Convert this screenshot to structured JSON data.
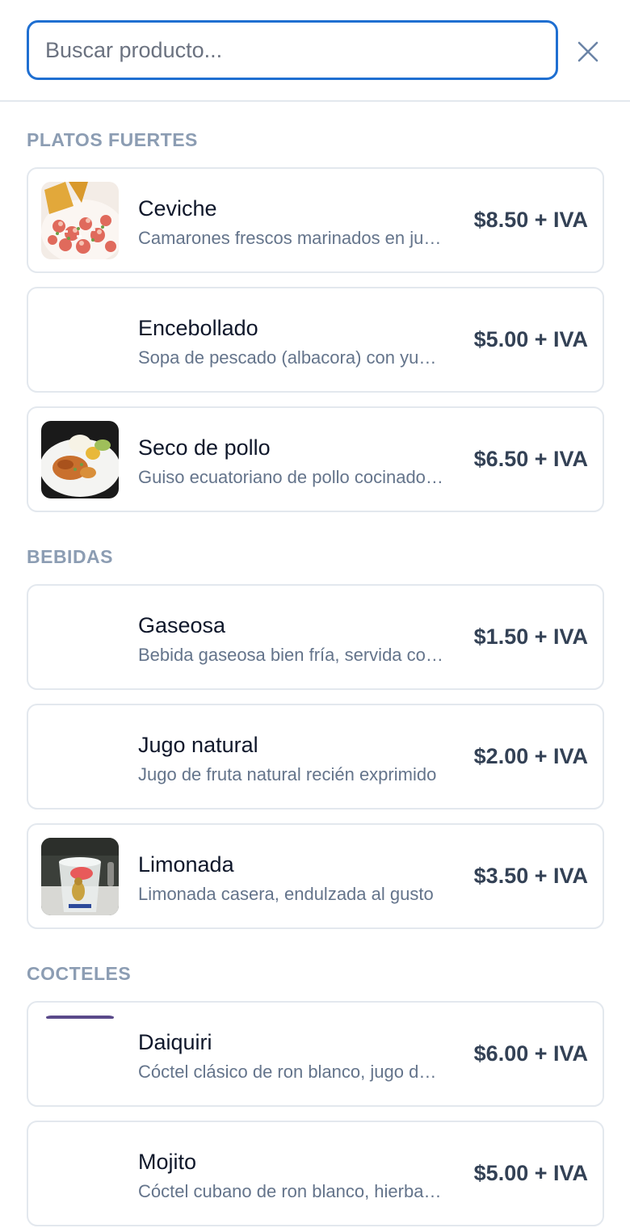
{
  "search": {
    "placeholder": "Buscar producto...",
    "value": ""
  },
  "sections": [
    {
      "title": "PLATOS FUERTES",
      "items": [
        {
          "name": "Ceviche",
          "description": "Camarones frescos marinados en jugo de limón",
          "price": "$8.50 + IVA",
          "image": "ceviche-photo"
        },
        {
          "name": "Encebollado",
          "description": "Sopa de pescado (albacora) con yuca y cebolla",
          "price": "$5.00 + IVA",
          "image": ""
        },
        {
          "name": "Seco de pollo",
          "description": "Guiso ecuatoriano de pollo cocinado con arroz",
          "price": "$6.50 + IVA",
          "image": "seco-de-pollo-photo"
        }
      ]
    },
    {
      "title": "BEBIDAS",
      "items": [
        {
          "name": "Gaseosa",
          "description": "Bebida gaseosa bien fría, servida con hielo",
          "price": "$1.50 + IVA",
          "image": ""
        },
        {
          "name": "Jugo natural",
          "description": "Jugo de fruta natural recién exprimido",
          "price": "$2.00 + IVA",
          "image": ""
        },
        {
          "name": "Limonada",
          "description": "Limonada casera, endulzada al gusto",
          "price": "$3.50 + IVA",
          "image": "limonada-photo"
        }
      ]
    },
    {
      "title": "COCTELES",
      "items": [
        {
          "name": "Daiquiri",
          "description": "Cóctel clásico de ron blanco, jugo de limón",
          "price": "$6.00 + IVA",
          "image": "daiquiri-photo"
        },
        {
          "name": "Mojito",
          "description": "Cóctel cubano de ron blanco, hierbabuena",
          "price": "$5.00 + IVA",
          "image": ""
        }
      ]
    }
  ],
  "colors": {
    "accent": "#1f6fd1",
    "section_title": "#8c9db3",
    "price": "#334155",
    "border": "#e3e8ee"
  }
}
